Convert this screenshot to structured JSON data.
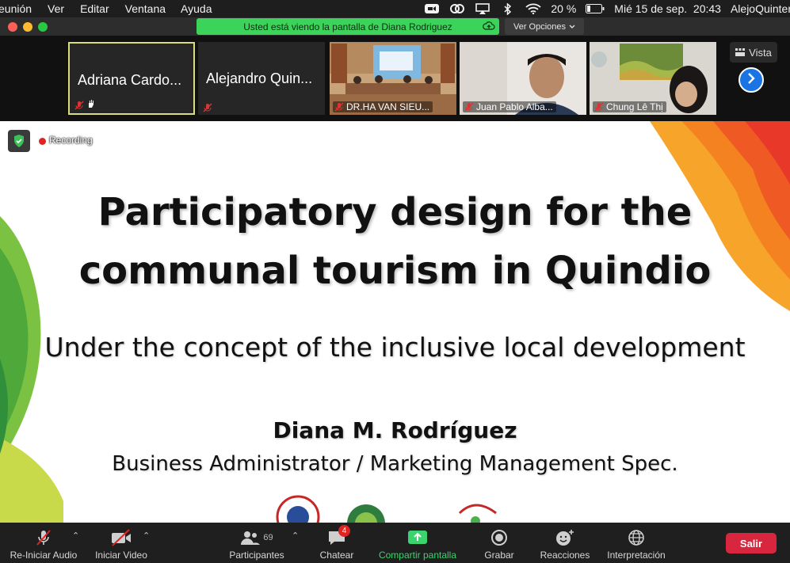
{
  "menubar": {
    "items": [
      "eunión",
      "Ver",
      "Editar",
      "Ventana",
      "Ayuda"
    ],
    "battery": "20 %",
    "datetime": "Mié 15 de sep.  20:43",
    "user": "AlejoQuinter"
  },
  "titlebar": {
    "banner": "Usted está viendo la pantalla de Diana Rodriguez",
    "view_options": "Ver Opciones"
  },
  "participants": [
    {
      "name": "Adriana Cardo..."
    },
    {
      "name": "Alejandro Quin..."
    },
    {
      "name": "DR.HA VAN SIEU..."
    },
    {
      "name": "Juan Pablo Alba..."
    },
    {
      "name": "Chung Lê Thị"
    }
  ],
  "strip": {
    "view_label": "Vista"
  },
  "slide": {
    "recording_label": "Recording",
    "title_line1": "Participatory design for the",
    "title_line2": "communal tourism in Quindio",
    "subtitle": "Under the concept of the inclusive local development",
    "author": "Diana M. Rodríguez",
    "role": "Business Administrator / Marketing Management Spec."
  },
  "toolbar": {
    "audio": "Re-Iniciar Audio",
    "video": "Iniciar Video",
    "participants": "Participantes",
    "participants_count": "69",
    "chat": "Chatear",
    "chat_badge": "4",
    "share": "Compartir pantalla",
    "record": "Grabar",
    "reactions": "Reacciones",
    "interpretation": "Interpretación",
    "leave": "Salir"
  },
  "colors": {
    "share_green": "#3cd35a",
    "leave_red": "#d7263d",
    "active_border": "#d9dd7d",
    "next_blue": "#1b74e4"
  }
}
